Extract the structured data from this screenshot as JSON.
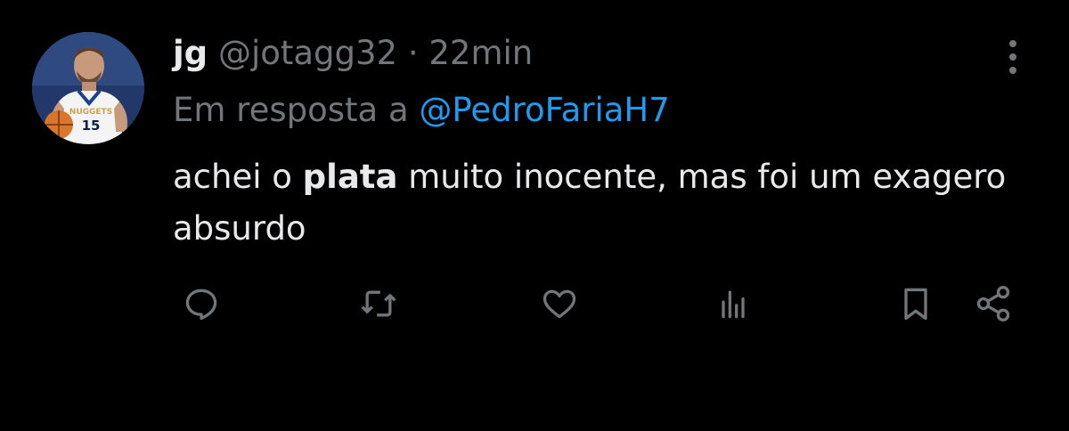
{
  "tweet": {
    "display_name": "jg",
    "handle": "@jotagg32",
    "separator": "·",
    "time": "22min",
    "reply_prefix": "Em resposta a",
    "reply_to": "@PedroFariaH7",
    "text_before": "achei o ",
    "text_bold": "plata",
    "text_after": " muito inocente, mas foi um exagero absurdo",
    "avatar_jersey": "NUGGETS",
    "avatar_number": "15"
  },
  "colors": {
    "background": "#000000",
    "text": "#e7e9ea",
    "muted": "#71767b",
    "link": "#1d9bf0"
  },
  "actions": [
    "reply-icon",
    "retweet-icon",
    "like-icon",
    "views-icon",
    "bookmark-icon",
    "share-icon"
  ]
}
